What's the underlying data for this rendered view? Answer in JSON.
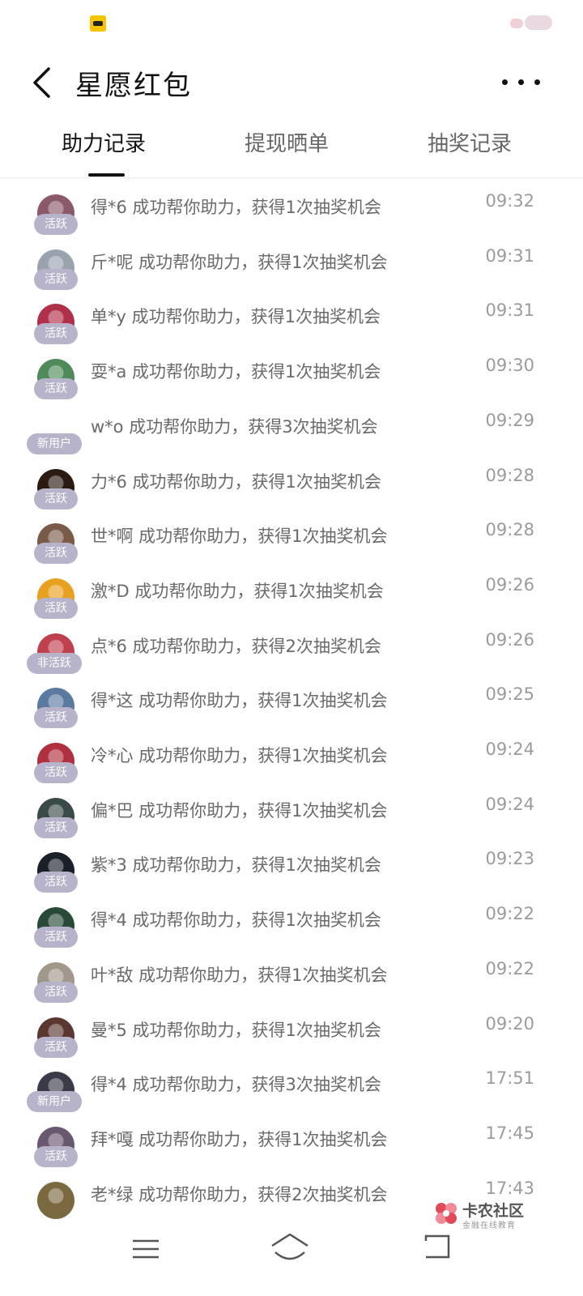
{
  "status_bar": {
    "left_icon": "app-notification-icon",
    "right_icon": "status-indicator-icon"
  },
  "header": {
    "title": "星愿红包",
    "back_icon": "back-arrow-icon",
    "more_icon": "more-dots-icon"
  },
  "tabs": [
    {
      "label": "助力记录",
      "active": true
    },
    {
      "label": "提现晒单",
      "active": false
    },
    {
      "label": "抽奖记录",
      "active": false
    }
  ],
  "records": [
    {
      "badge": "活跃",
      "text": "得*6 成功帮你助力，获得1次抽奖机会",
      "time": "09:32",
      "avatar_color": "#8a5a6b"
    },
    {
      "badge": "活跃",
      "text": "斤*呢 成功帮你助力，获得1次抽奖机会",
      "time": "09:31",
      "avatar_color": "#9aa2b0"
    },
    {
      "badge": "活跃",
      "text": "单*y 成功帮你助力，获得1次抽奖机会",
      "time": "09:31",
      "avatar_color": "#b0304a"
    },
    {
      "badge": "活跃",
      "text": "耍*a 成功帮你助力，获得1次抽奖机会",
      "time": "09:30",
      "avatar_color": "#4f8a5a"
    },
    {
      "badge": "新用户",
      "text": "w*o 成功帮你助力，获得3次抽奖机会",
      "time": "09:29",
      "avatar_color": "#ffffff"
    },
    {
      "badge": "活跃",
      "text": "力*6 成功帮你助力，获得1次抽奖机会",
      "time": "09:28",
      "avatar_color": "#2a1a10"
    },
    {
      "badge": "活跃",
      "text": "世*啊 成功帮你助力，获得1次抽奖机会",
      "time": "09:28",
      "avatar_color": "#7a5a48"
    },
    {
      "badge": "活跃",
      "text": "激*D 成功帮你助力，获得1次抽奖机会",
      "time": "09:26",
      "avatar_color": "#e8a020"
    },
    {
      "badge": "非活跃",
      "text": "点*6 成功帮你助力，获得2次抽奖机会",
      "time": "09:26",
      "avatar_color": "#c04050"
    },
    {
      "badge": "活跃",
      "text": "得*这 成功帮你助力，获得1次抽奖机会",
      "time": "09:25",
      "avatar_color": "#5a7aa0"
    },
    {
      "badge": "活跃",
      "text": "冷*心 成功帮你助力，获得1次抽奖机会",
      "time": "09:24",
      "avatar_color": "#b03040"
    },
    {
      "badge": "活跃",
      "text": "偏*巴 成功帮你助力，获得1次抽奖机会",
      "time": "09:24",
      "avatar_color": "#3a4a48"
    },
    {
      "badge": "活跃",
      "text": "紫*3 成功帮你助力，获得1次抽奖机会",
      "time": "09:23",
      "avatar_color": "#1a2028"
    },
    {
      "badge": "活跃",
      "text": "得*4 成功帮你助力，获得1次抽奖机会",
      "time": "09:22",
      "avatar_color": "#2a4a38"
    },
    {
      "badge": "活跃",
      "text": "叶*敌 成功帮你助力，获得1次抽奖机会",
      "time": "09:22",
      "avatar_color": "#a0988a"
    },
    {
      "badge": "活跃",
      "text": "曼*5 成功帮你助力，获得1次抽奖机会",
      "time": "09:20",
      "avatar_color": "#5a3830"
    },
    {
      "badge": "新用户",
      "text": "得*4 成功帮你助力，获得3次抽奖机会",
      "time": "17:51",
      "avatar_color": "#3a3a48"
    },
    {
      "badge": "活跃",
      "text": "拜*嘎 成功帮你助力，获得1次抽奖机会",
      "time": "17:45",
      "avatar_color": "#6a5870"
    },
    {
      "badge": "",
      "text": "老*绿 成功帮你助力，获得2次抽奖机会",
      "time": "17:43",
      "avatar_color": "#7a6840"
    }
  ],
  "watermark": {
    "title": "卡农社区",
    "subtitle": "金融在线教育"
  },
  "nav_bar": {
    "menu_icon": "menu-icon",
    "home_icon": "home-icon",
    "back_icon": "nav-back-icon"
  }
}
